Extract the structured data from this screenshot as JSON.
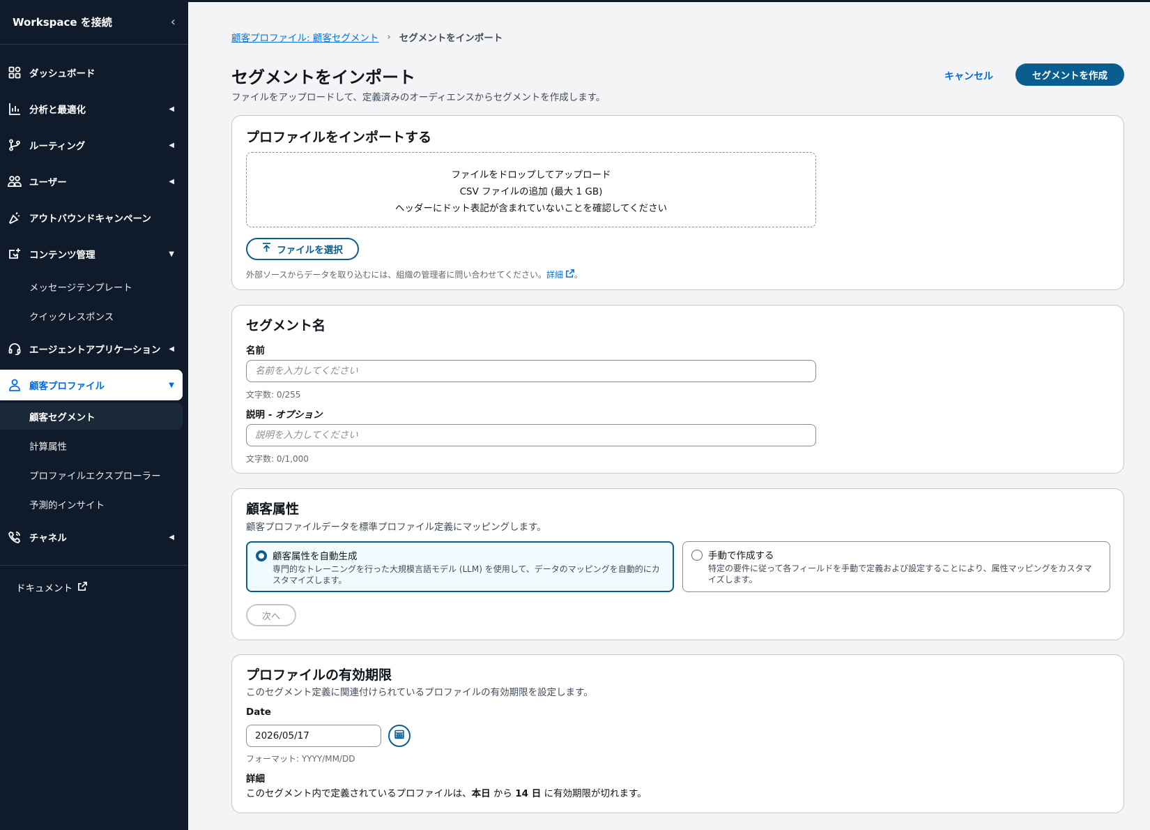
{
  "sidebar": {
    "title": "Workspace を接続",
    "collapse_icon": "chevron-left-icon",
    "items": [
      {
        "label": "ダッシュボード",
        "icon": "dashboard-icon"
      },
      {
        "label": "分析と最適化",
        "icon": "chart-icon"
      },
      {
        "label": "ルーティング",
        "icon": "routing-icon"
      },
      {
        "label": "ユーザー",
        "icon": "users-icon"
      },
      {
        "label": "アウトバウンドキャンペーン",
        "icon": "megaphone-icon"
      },
      {
        "label": "コンテンツ管理",
        "icon": "content-icon"
      },
      {
        "label": "エージェントアプリケーション",
        "icon": "headset-icon"
      },
      {
        "label": "顧客プロファイル",
        "icon": "person-icon"
      },
      {
        "label": "チャネル",
        "icon": "phone-icon"
      }
    ],
    "content_sub": [
      "メッセージテンプレート",
      "クイックレスポンス"
    ],
    "profile_sub": [
      "顧客セグメント",
      "計算属性",
      "プロファイルエクスプローラー",
      "予測的インサイト"
    ],
    "docs_label": "ドキュメント"
  },
  "breadcrumb": {
    "parent": "顧客プロファイル: 顧客セグメント",
    "current": "セグメントをインポート"
  },
  "header": {
    "title": "セグメントをインポート",
    "description": "ファイルをアップロードして、定義済みのオーディエンスからセグメントを作成します。",
    "cancel_label": "キャンセル",
    "create_label": "セグメントを作成"
  },
  "import_card": {
    "title": "プロファイルをインポートする",
    "drop_line1": "ファイルをドロップしてアップロード",
    "drop_line2": "CSV ファイルの追加 (最大 1 GB)",
    "drop_line3": "ヘッダーにドット表記が含まれていないことを確認してください",
    "choose_file_label": "ファイルを選択",
    "hint": "外部ソースからデータを取り込むには、組織の管理者に問い合わせてください。",
    "hint_link": "詳細",
    "hint_end": "。"
  },
  "segment_card": {
    "title": "セグメント名",
    "name_label": "名前",
    "name_placeholder": "名前を入力してください",
    "name_count": "文字数: 0/255",
    "desc_label": "説明 - ",
    "desc_label_optional": "オプション",
    "desc_placeholder": "説明を入力してください",
    "desc_count": "文字数: 0/1,000"
  },
  "attributes_card": {
    "title": "顧客属性",
    "description": "顧客プロファイルデータを標準プロファイル定義にマッピングします。",
    "option_auto_title": "顧客属性を自動生成",
    "option_auto_desc": "専門的なトレーニングを行った大規模言語モデル (LLM) を使用して、データのマッピングを自動的にカスタマイズします。",
    "option_manual_title": "手動で作成する",
    "option_manual_desc": "特定の要件に従って各フィールドを手動で定義および設定することにより、属性マッピングをカスタマイズします。",
    "next_label": "次へ"
  },
  "expiry_card": {
    "title": "プロファイルの有効期限",
    "description": "このセグメント定義に関連付けられているプロファイルの有効期限を設定します。",
    "date_label": "Date",
    "date_value": "2026/05/17",
    "format_hint": "フォーマット: YYYY/MM/DD",
    "detail_label": "詳細",
    "detail_prefix": "このセグメント内で定義されているプロファイルは、",
    "detail_from": "本日",
    "detail_mid": " から ",
    "detail_days": "14 日",
    "detail_suffix": " に有効期限が切れます。"
  },
  "colors": {
    "sidebar_bg": "#0f1b2a",
    "primary": "#0a5e8f",
    "link": "#0972d3"
  }
}
